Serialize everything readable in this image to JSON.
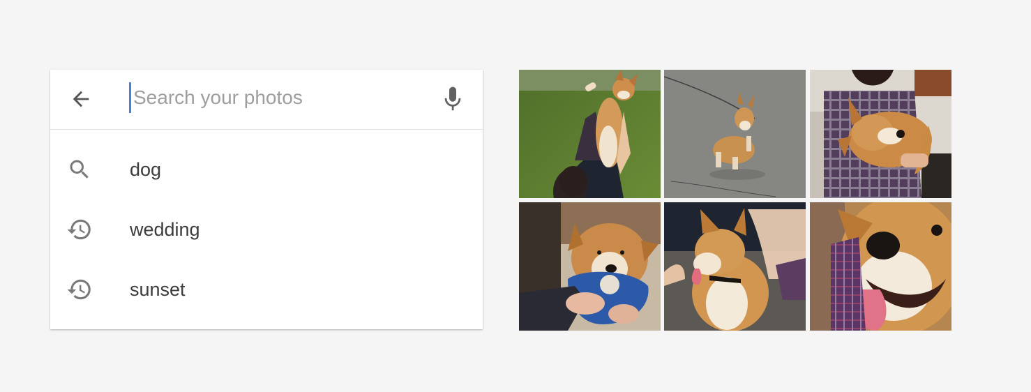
{
  "search": {
    "placeholder": "Search your photos",
    "value": ""
  },
  "suggestions": [
    {
      "label": "dog",
      "icon": "search-icon"
    },
    {
      "label": "wedding",
      "icon": "history-icon"
    },
    {
      "label": "sunset",
      "icon": "history-icon"
    }
  ],
  "colors": {
    "background": "#f5f5f5",
    "card": "#ffffff",
    "caret": "#4a7fd3",
    "icon": "#757575",
    "text": "#3c3c3c",
    "placeholder": "#9e9e9e"
  },
  "photos": [
    {
      "name": "corgi-grass"
    },
    {
      "name": "corgi-pavement"
    },
    {
      "name": "corgi-held"
    },
    {
      "name": "corgi-toy"
    },
    {
      "name": "corgi-pet"
    },
    {
      "name": "corgi-closeup"
    }
  ]
}
